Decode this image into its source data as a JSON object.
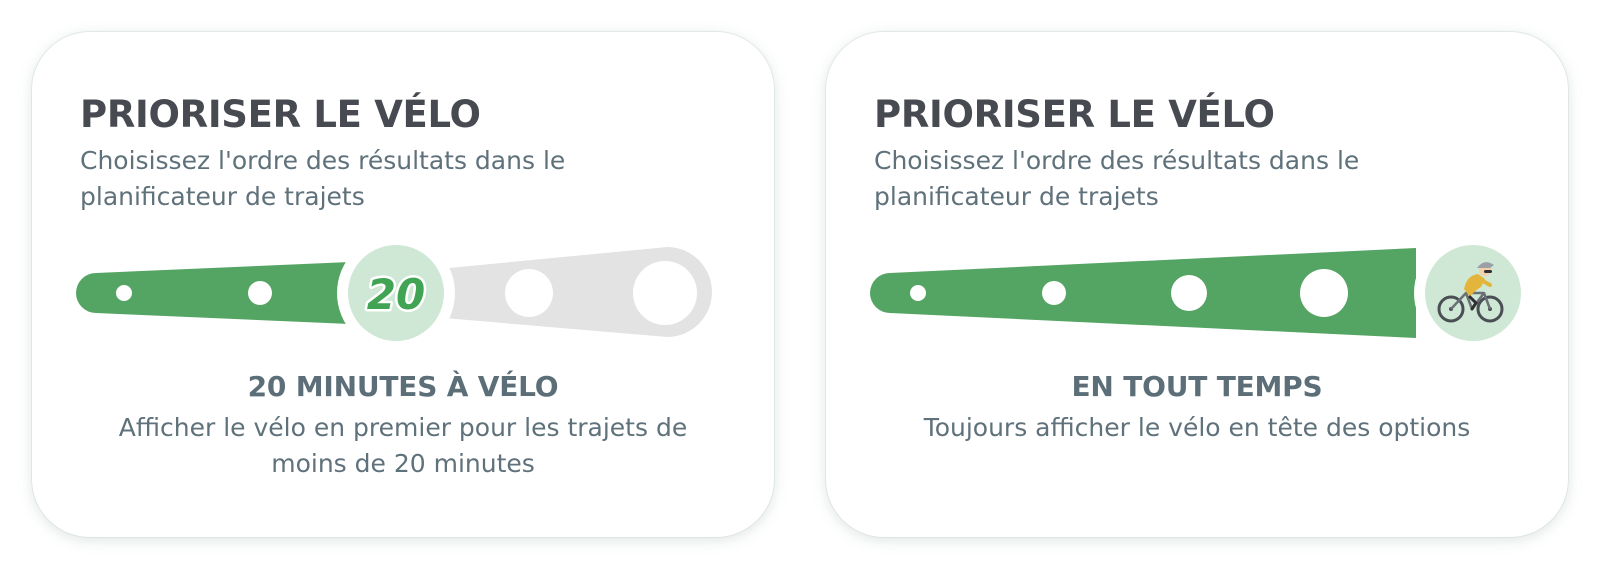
{
  "colors": {
    "accent": "#54a463",
    "track_inactive": "#e3e3e3",
    "knob_fill": "#cfe8d5",
    "knob_text": "#40a454",
    "title_text": "#474a51",
    "body_text": "#5f717a"
  },
  "cards": [
    {
      "title": "PRIORISER LE VÉLO",
      "subtitle": "Choisissez l'ordre des résultats dans le planificateur de trajets",
      "slider": {
        "steps": 5,
        "selected_step": 3,
        "knob_label": "20"
      },
      "option_title": "20 MINUTES À VÉLO",
      "option_description": "Afficher le vélo en premier pour les trajets de moins de 20 minutes"
    },
    {
      "title": "PRIORISER LE VÉLO",
      "subtitle": "Choisissez l'ordre des résultats dans le planificateur de trajets",
      "slider": {
        "steps": 5,
        "selected_step": 5,
        "knob_icon": "cyclist-icon"
      },
      "option_title": "EN TOUT TEMPS",
      "option_description": "Toujours afficher le vélo en tête des options"
    }
  ]
}
